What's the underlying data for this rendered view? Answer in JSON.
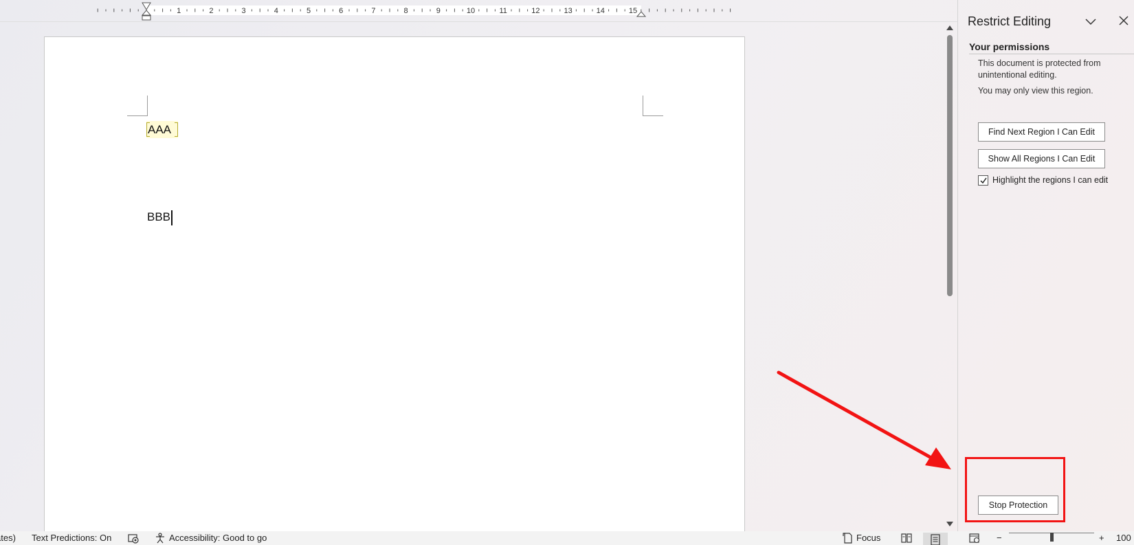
{
  "ruler": {
    "numbers": [
      "1",
      "2",
      "3",
      "4",
      "5",
      "6",
      "7",
      "8",
      "9",
      "10",
      "11",
      "12",
      "13",
      "14",
      "15"
    ]
  },
  "document": {
    "region_text": "AAA",
    "line2_text": "BBB"
  },
  "task_pane": {
    "title": "Restrict Editing",
    "section_heading": "Your permissions",
    "protected_text": "This document is protected from unintentional editing.",
    "view_text": "You may only view this region.",
    "find_next_label": "Find Next Region I Can Edit",
    "show_all_label": "Show All Regions I Can Edit",
    "highlight_label": "Highlight the regions I can edit",
    "highlight_checked": true,
    "stop_protection_label": "Stop Protection"
  },
  "status_bar": {
    "language_fragment": "ates)",
    "text_predictions": "Text Predictions: On",
    "accessibility": "Accessibility: Good to go",
    "focus": "Focus",
    "zoom_minus": "−",
    "zoom_plus": "+",
    "zoom_fragment": "100"
  },
  "colors": {
    "annotation_red": "#f21313",
    "region_highlight": "#fffbd6",
    "region_bracket": "#b4aa2a"
  },
  "icons": {
    "pane_options": "chevron-down-icon",
    "pane_close": "close-icon",
    "checkbox": "checkmark-icon",
    "macro": "macro-recording-icon",
    "accessibility": "accessibility-person-icon",
    "focus": "focus-icon",
    "read_mode": "read-mode-icon",
    "print_layout": "print-layout-icon",
    "web_layout": "web-layout-icon"
  }
}
